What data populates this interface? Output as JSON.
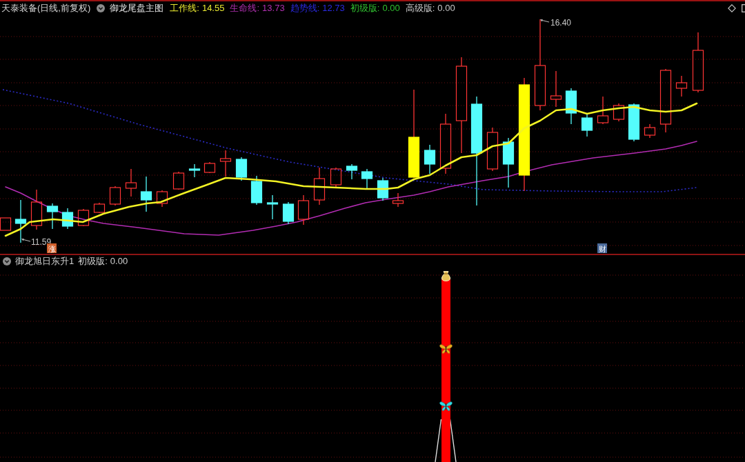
{
  "header": {
    "title": "天泰装备(日线,前复权)",
    "indicator": "御龙尾盘主图",
    "lines": [
      {
        "label": "工作线:",
        "value": "14.55",
        "color": "#e8e830"
      },
      {
        "label": "生命线:",
        "value": "13.73",
        "color": "#b030b0"
      },
      {
        "label": "趋势线:",
        "value": "12.73",
        "color": "#2a2ae0"
      },
      {
        "label": "初级版:",
        "value": "0.00",
        "color": "#30c030"
      },
      {
        "label": "高级版:",
        "value": "0.00",
        "color": "#c8c8c8"
      }
    ]
  },
  "price_chart": {
    "high_label": "16.40",
    "low_label": "11.59",
    "markers": [
      {
        "text": "涨",
        "color": "#d2602c"
      },
      {
        "text": "财",
        "color": "#4c6c9c"
      }
    ]
  },
  "sub_panel": {
    "indicator": "御龙旭日东升1",
    "lines": [
      {
        "label": "初级版:",
        "value": "0.00"
      }
    ]
  }
}
